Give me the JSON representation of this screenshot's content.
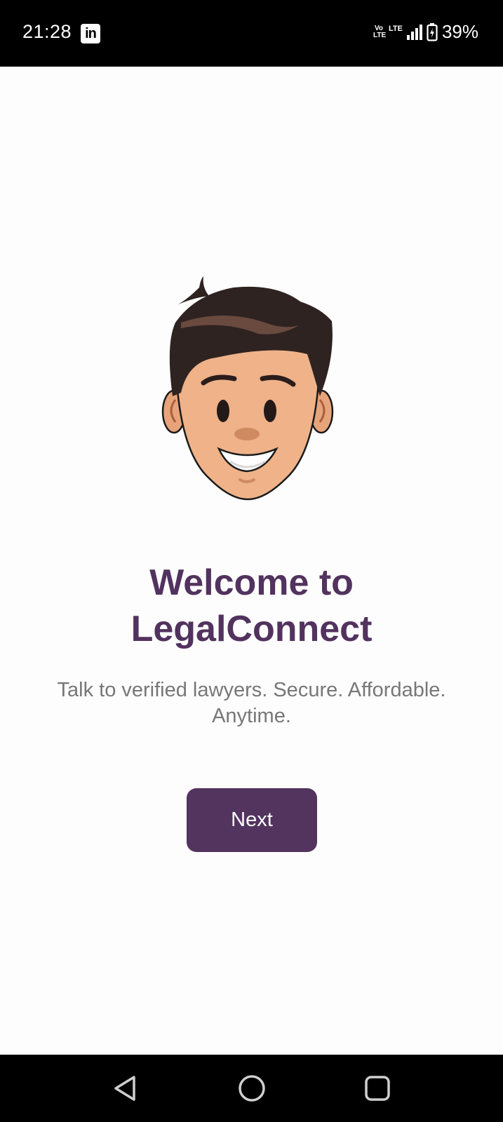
{
  "status_bar": {
    "time": "21:28",
    "app_icon": "linkedin-icon",
    "linkedin_text": "in",
    "volte_text": "Vo LTE",
    "lte_text": "LTE",
    "battery": "39%"
  },
  "welcome": {
    "title_line1": "Welcome to",
    "title_line2": "LegalConnect",
    "subtitle": "Talk to verified lawyers. Secure. Affordable. Anytime.",
    "illustration": "smiling-face-illustration"
  },
  "actions": {
    "next_label": "Next"
  },
  "nav_bar": {
    "back": "back-triangle-icon",
    "home": "home-circle-icon",
    "recents": "recents-square-icon"
  },
  "colors": {
    "accent": "#52325e",
    "button": "#52345f",
    "subtitle": "#777777",
    "background": "#fdfdfd"
  }
}
